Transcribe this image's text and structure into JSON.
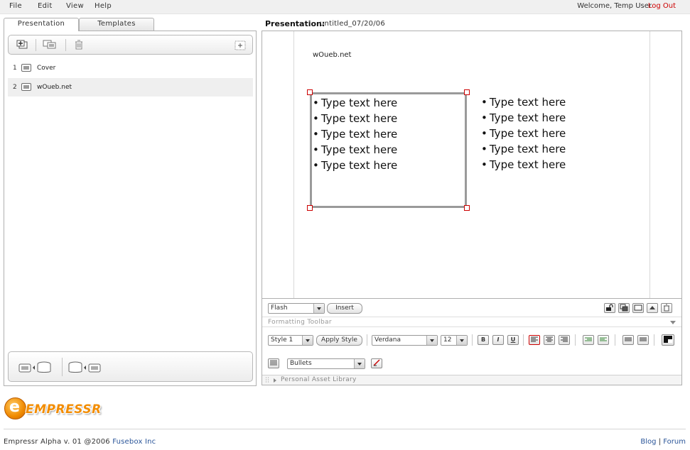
{
  "menubar": {
    "items": [
      "File",
      "Edit",
      "View",
      "Help"
    ],
    "welcome": "Welcome, Temp User",
    "logout": "Log Out"
  },
  "tabs": [
    {
      "label": "Presentation",
      "active": true
    },
    {
      "label": "Templates",
      "active": false
    }
  ],
  "slides": [
    {
      "number": "1",
      "label": "Cover"
    },
    {
      "number": "2",
      "label": "wOueb.net",
      "selected": true
    }
  ],
  "presentation": {
    "label": "Presentation:",
    "name": "untitled_07/20/06"
  },
  "canvas": {
    "slide_title": "wOueb.net",
    "left_bullets": [
      "Type text here",
      "Type text here",
      "Type text here",
      "Type text here",
      "Type text here"
    ],
    "right_bullets": [
      "Type text here",
      "Type text here",
      "Type text here",
      "Type text here",
      "Type text here"
    ]
  },
  "insert_row": {
    "media_type": "Flash",
    "insert_label": "Insert"
  },
  "formatting": {
    "label": "Formatting Toolbar",
    "style": "Style 1",
    "apply_style": "Apply Style",
    "font": "Verdana",
    "size": "12",
    "bold": "B",
    "italic": "I",
    "underline": "U",
    "list_type": "Bullets"
  },
  "asset_library": {
    "label": "Personal Asset Library"
  },
  "logo": {
    "letter": "e",
    "text": "EMPRESSR"
  },
  "footer": {
    "version": "Empressr Alpha v. 01 @2006 ",
    "company": "Fusebox Inc",
    "blog": "Blog",
    "separator": "|",
    "forum": "Forum"
  },
  "colors": {
    "accent": "#cc0000",
    "brand": "#f28c00",
    "link": "#2a5599"
  }
}
